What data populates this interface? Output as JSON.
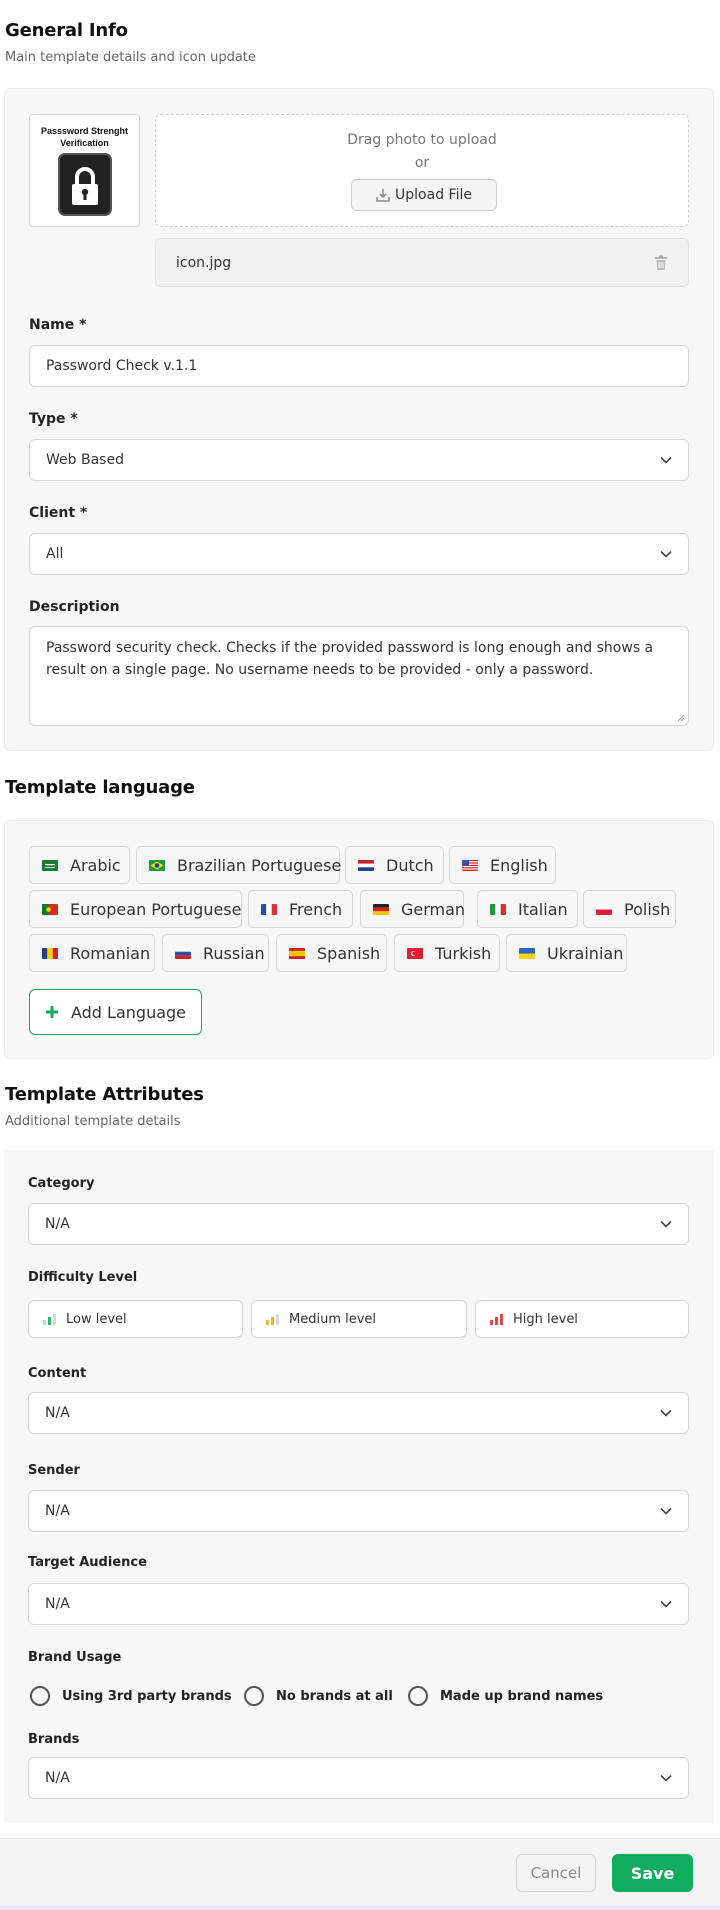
{
  "general": {
    "title": "General Info",
    "subtitle": "Main template details and icon update",
    "thumbnail_caption": "Passsword Strenght Verification",
    "upload": {
      "drag_text": "Drag photo to upload",
      "or_text": "or",
      "button_label": "Upload File"
    },
    "file": {
      "name": "icon.jpg"
    },
    "name": {
      "label": "Name *",
      "value": "Password Check v.1.1"
    },
    "type": {
      "label": "Type *",
      "value": "Web Based"
    },
    "client": {
      "label": "Client *",
      "value": "All"
    },
    "description": {
      "label": "Description",
      "value": "Password security check. Checks if the provided password is long enough and shows a result on a single page. No username needs to be provided - only a password."
    }
  },
  "language": {
    "title": "Template language",
    "items": [
      {
        "label": "Arabic",
        "flag": "flag-sa-icon"
      },
      {
        "label": "Brazilian Portuguese",
        "flag": "flag-br-icon"
      },
      {
        "label": "Dutch",
        "flag": "flag-nl-icon"
      },
      {
        "label": "English",
        "flag": "flag-us-icon"
      },
      {
        "label": "European Portuguese",
        "flag": "flag-pt-icon"
      },
      {
        "label": "French",
        "flag": "flag-fr-icon"
      },
      {
        "label": "German",
        "flag": "flag-de-icon"
      },
      {
        "label": "Italian",
        "flag": "flag-it-icon"
      },
      {
        "label": "Polish",
        "flag": "flag-pl-icon"
      },
      {
        "label": "Romanian",
        "flag": "flag-ro-icon"
      },
      {
        "label": "Russian",
        "flag": "flag-ru-icon"
      },
      {
        "label": "Spanish",
        "flag": "flag-es-icon"
      },
      {
        "label": "Turkish",
        "flag": "flag-tr-icon"
      },
      {
        "label": "Ukrainian",
        "flag": "flag-ua-icon"
      }
    ],
    "add_button": "Add Language"
  },
  "attributes": {
    "title": "Template Attributes",
    "subtitle": "Additional template details",
    "category": {
      "label": "Category",
      "value": "N/A"
    },
    "difficulty": {
      "label": "Difficulty Level",
      "options": [
        {
          "label": "Low level",
          "color": "#2eb872"
        },
        {
          "label": "Medium level",
          "color": "#f2b53a"
        },
        {
          "label": "High level",
          "color": "#e5484d"
        }
      ]
    },
    "content": {
      "label": "Content",
      "value": "N/A"
    },
    "sender": {
      "label": "Sender",
      "value": "N/A"
    },
    "audience": {
      "label": "Target Audience",
      "value": "N/A"
    },
    "brand_usage": {
      "label": "Brand Usage",
      "options": [
        "Using 3rd party brands",
        "No brands at all",
        "Made up brand names"
      ]
    },
    "brands": {
      "label": "Brands",
      "value": "N/A"
    }
  },
  "footer": {
    "cancel_label": "Cancel",
    "save_label": "Save"
  },
  "colors": {
    "accent": "#0fad5d",
    "panel": "#f7f7f7",
    "border": "#d6d6d6"
  }
}
